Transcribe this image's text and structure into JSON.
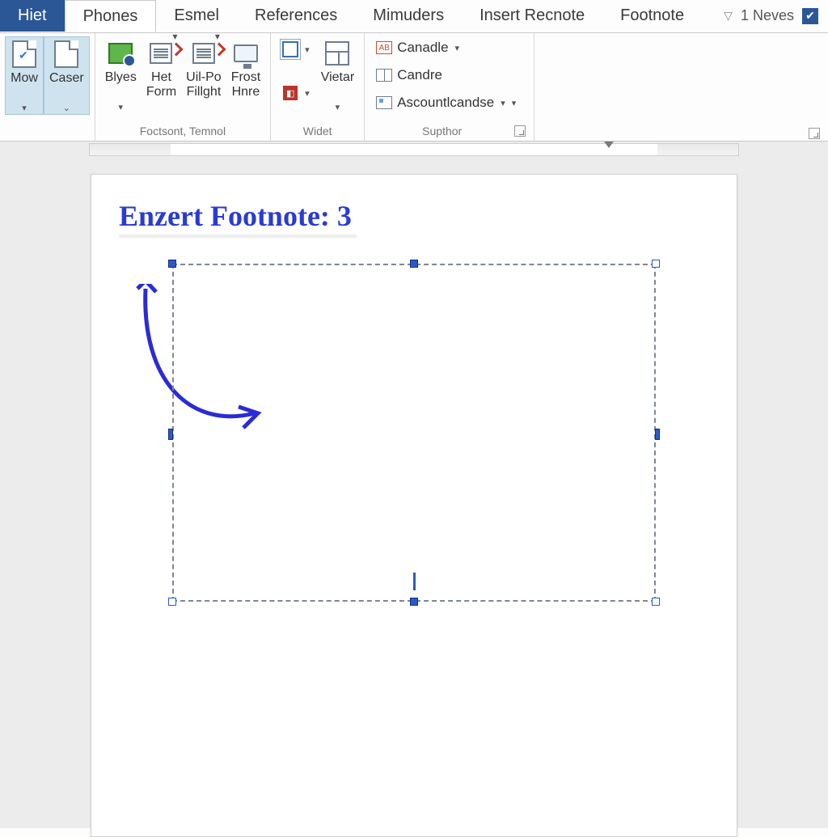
{
  "tabs": {
    "file": "Hiet",
    "items": [
      "Phones",
      "Esmel",
      "References",
      "Mimuders",
      "Insert Recnote",
      "Footnote"
    ],
    "active_index": 0,
    "extra": {
      "chev": "▽",
      "label": "1 Neves"
    }
  },
  "ribbon": {
    "group1": {
      "label": "",
      "btn1": {
        "l1": "Mow",
        "drop": "▾"
      },
      "btn2": {
        "l1": "Caser",
        "drop": "⌄"
      }
    },
    "group2": {
      "label": "Foctsont, Temnol",
      "btn1": {
        "l1": "Blyes",
        "drop": "▾"
      },
      "btn2": {
        "l1": "Het",
        "l2": "Form"
      },
      "btn3": {
        "l1": "Uil-Po",
        "l2": "Fillght"
      },
      "btn4": {
        "l1": "Frost",
        "l2": "Hnre"
      }
    },
    "group3": {
      "label": "Widet",
      "small1": "",
      "small2": "",
      "btn1": {
        "l1": "Vietar",
        "drop": "▾"
      }
    },
    "group4": {
      "label": "Supthor",
      "row1": "Canadle",
      "row2": "Candre",
      "row3": "Ascountlcandse"
    }
  },
  "document": {
    "heading": "Enzert Footnote: 3"
  }
}
